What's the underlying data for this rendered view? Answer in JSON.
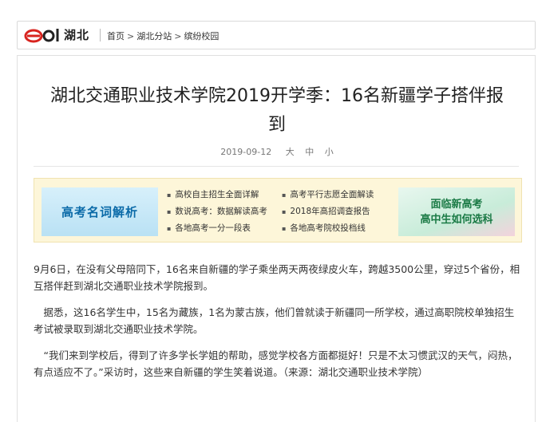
{
  "header": {
    "logo_text": "eol",
    "region": "湖北",
    "breadcrumb": [
      "首页",
      "湖北分站",
      "缤纷校园"
    ],
    "breadcrumb_sep": ">"
  },
  "article": {
    "title_line1": "湖北交通职业技术学院2019开学季：16名新疆学子搭伴报",
    "title_line2": "到",
    "date": "2019-09-12",
    "font_sizes": [
      "大",
      "中",
      "小"
    ],
    "paragraphs": [
      " 9月6日，在没有父母陪同下，16名来自新疆的学子乘坐两天两夜绿皮火车，跨越3500公里，穿过5个省份，相互搭伴赶到湖北交通职业技术学院报到。",
      "　据悉，这16名学生中，15名为藏族，1名为蒙古族，他们曾就读于新疆同一所学校，通过高职院校单独招生考试被录取到湖北交通职业技术学院。",
      "　“我们来到学校后，得到了许多学长学姐的帮助，感觉学校各方面都挺好！只是不太习惯武汉的天气，闷热，有点适应不了。”采访时，这些来自新疆的学生笑着说道。（来源：湖北交通职业技术学院）"
    ]
  },
  "promo": {
    "left_banner": "高考名词解析",
    "right_banner_line1": "面临新高考",
    "right_banner_line2": "高中生如何选科",
    "col1": [
      "高校自主招生全面详解",
      "数说高考：数据解读高考",
      "各地高考一分一段表"
    ],
    "col2": [
      "高考平行志愿全面解读",
      "2018年高招调查报告",
      "各地高考院校投档线"
    ]
  },
  "colors": {
    "logo_red": "#d8241f",
    "promo_bg": "#fdf6d9",
    "promo_left_text": "#0a6aa8",
    "promo_right_text": "#1a7a45"
  }
}
